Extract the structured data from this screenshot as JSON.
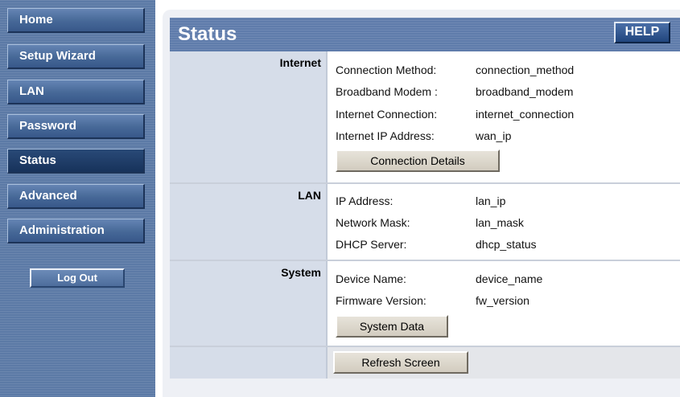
{
  "sidebar": {
    "items": [
      {
        "label": "Home"
      },
      {
        "label": "Setup Wizard"
      },
      {
        "label": "LAN"
      },
      {
        "label": "Password"
      },
      {
        "label": "Status"
      },
      {
        "label": "Advanced"
      },
      {
        "label": "Administration"
      }
    ],
    "active": "Status",
    "logout_label": "Log Out"
  },
  "header": {
    "title": "Status",
    "help_label": "HELP"
  },
  "sections": {
    "internet": {
      "title": "Internet",
      "rows": [
        {
          "label": "Connection Method:",
          "value": "connection_method"
        },
        {
          "label": "Broadband Modem :",
          "value": "broadband_modem"
        },
        {
          "label": "Internet Connection:",
          "value": "internet_connection"
        },
        {
          "label": "Internet IP Address:",
          "value": "wan_ip"
        }
      ],
      "button_label": "Connection Details"
    },
    "lan": {
      "title": "LAN",
      "rows": [
        {
          "label": "IP Address:",
          "value": "lan_ip"
        },
        {
          "label": "Network Mask:",
          "value": "lan_mask"
        },
        {
          "label": "DHCP Server:",
          "value": "dhcp_status"
        }
      ]
    },
    "system": {
      "title": "System",
      "rows": [
        {
          "label": "Device Name:",
          "value": "device_name"
        },
        {
          "label": "Firmware Version:",
          "value": "fw_version"
        }
      ],
      "button_label": "System Data"
    }
  },
  "refresh_label": "Refresh Screen",
  "colors": {
    "sidebar_bg": "#5c7aa6",
    "nav_active": "#17325a",
    "header_bg": "#5f7cab",
    "label_column": "#d6dde9"
  }
}
